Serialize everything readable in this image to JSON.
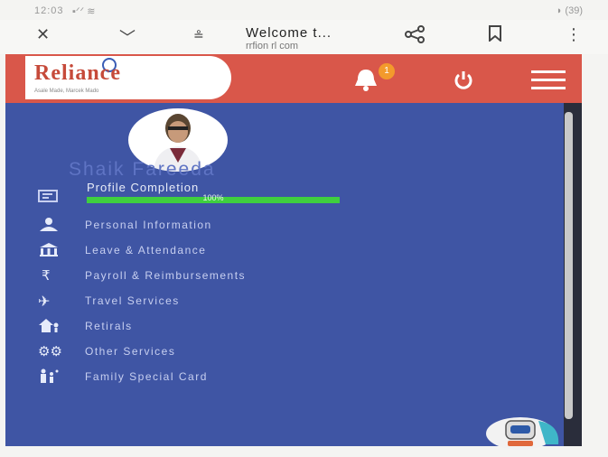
{
  "status_bar": {
    "time": "12:03",
    "signal": "▪ᐟᐟ ≋",
    "right": "◗ (39)"
  },
  "browser": {
    "close_icon": "close-icon",
    "title": "Welcome t...",
    "url": "rrfion rl com"
  },
  "header": {
    "logo_text": "Reliance",
    "logo_sub": "Asale Made, Marcek Mado",
    "notification_count": "1"
  },
  "profile": {
    "name": "Shaik Fareeda",
    "completion_label": "Profile Completion",
    "completion_value": "100%",
    "completion_fraction": 1.0
  },
  "menu_items": [
    {
      "label": "Personal Information",
      "icon": "person-icon"
    },
    {
      "label": "Leave & Attendance",
      "icon": "building-icon"
    },
    {
      "label": "Payroll & Reimbursements",
      "icon": "rupee-icon"
    },
    {
      "label": "Travel Services",
      "icon": "airplane-icon"
    },
    {
      "label": "Retirals",
      "icon": "home-person-icon"
    },
    {
      "label": "Other Services",
      "icon": "gears-icon"
    },
    {
      "label": "Family Special Card",
      "icon": "family-icon"
    }
  ],
  "colors": {
    "header": "#d9574a",
    "panel": "#3f55a4",
    "progress": "#3fcf3f",
    "badge": "#f39a2c"
  }
}
